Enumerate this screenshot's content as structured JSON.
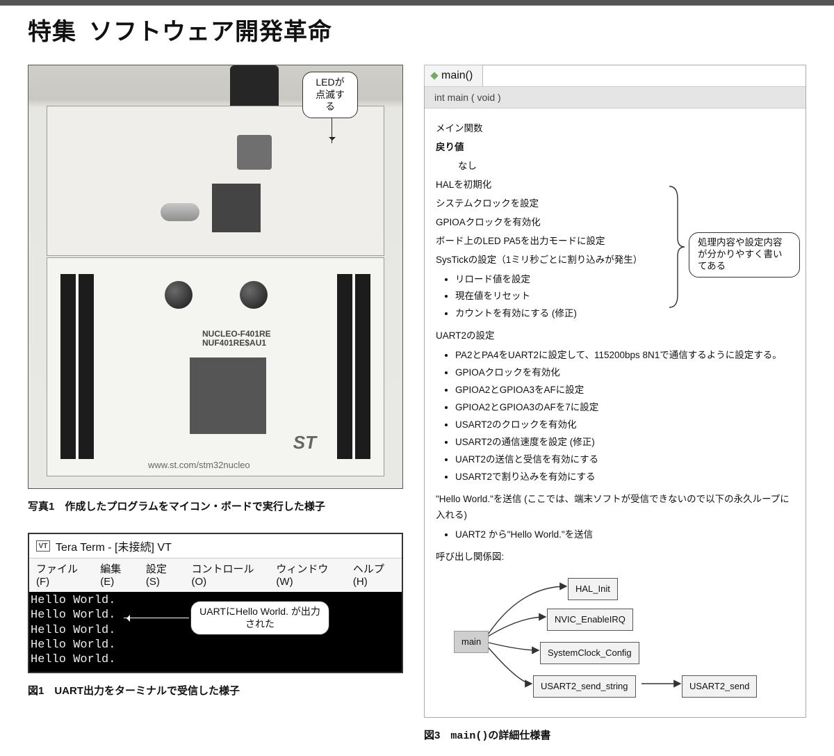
{
  "header": {
    "kicker": "特集",
    "title": "ソフトウェア開発革命"
  },
  "photo1": {
    "callout_led": "LEDが\n点滅する",
    "board_model_line1": "NUCLEO-F401RE",
    "board_model_line2": "NUF401RE$AU1",
    "board_url": "www.st.com/stm32nucleo",
    "st_logo": "ST",
    "caption": "写真1　作成したプログラムをマイコン・ボードで実行した様子"
  },
  "teraterm": {
    "icon_text": "VT",
    "title": "Tera Term - [未接続] VT",
    "menu": {
      "file": "ファイル(F)",
      "edit": "編集(E)",
      "setup": "設定(S)",
      "control": "コントロール(O)",
      "window": "ウィンドウ(W)",
      "help": "ヘルプ(H)"
    },
    "lines": [
      "Hello World.",
      "Hello World.",
      "Hello World.",
      "Hello World.",
      "Hello World."
    ],
    "callout_uart": "UARTにHello World.\nが出力された",
    "caption": "図1　UART出力をターミナルで受信した様子"
  },
  "spec": {
    "tab_label": "main()",
    "signature": "int main ( void   )",
    "p_main_fn": "メイン関数",
    "p_return_label": "戻り値",
    "p_return_value": "なし",
    "steps_top": [
      "HALを初期化",
      "システムクロックを設定",
      "GPIOAクロックを有効化",
      "ボード上のLED PA5を出力モードに設定",
      "SysTickの設定（1ミリ秒ごとに割り込みが発生）"
    ],
    "systick_items": [
      "リロード値を設定",
      "現在値をリセット",
      "カウントを有効にする (修正)"
    ],
    "uart2_header": "UART2の設定",
    "uart2_items": [
      "PA2とPA4をUART2に設定して、115200bps 8N1で通信するように設定する。",
      "GPIOAクロックを有効化",
      "GPIOA2とGPIOA3をAFに設定",
      "GPIOA2とGPIOA3のAFを7に設定",
      "USART2のクロックを有効化",
      "USART2の通信速度を設定 (修正)",
      "UART2の送信と受信を有効にする",
      "USART2で割り込みを有効にする"
    ],
    "hello_line": "\"Hello World.\"を送信 (ここでは、端末ソフトが受信できないので以下の永久ループに入れる)",
    "hello_item": "UART2 から\"Hello World.\"を送信",
    "graph_header": "呼び出し関係図:",
    "callout_spec": "処理内容や設定内容が分かりやすく書いてある",
    "graph_nodes": {
      "main": "main",
      "hal": "HAL_Init",
      "nvic": "NVIC_EnableIRQ",
      "sysclk": "SystemClock_Config",
      "sendstr": "USART2_send_string",
      "send": "USART2_send"
    },
    "caption_prefix": "図3　",
    "caption_mono": "main()",
    "caption_suffix": "の詳細仕様書"
  }
}
